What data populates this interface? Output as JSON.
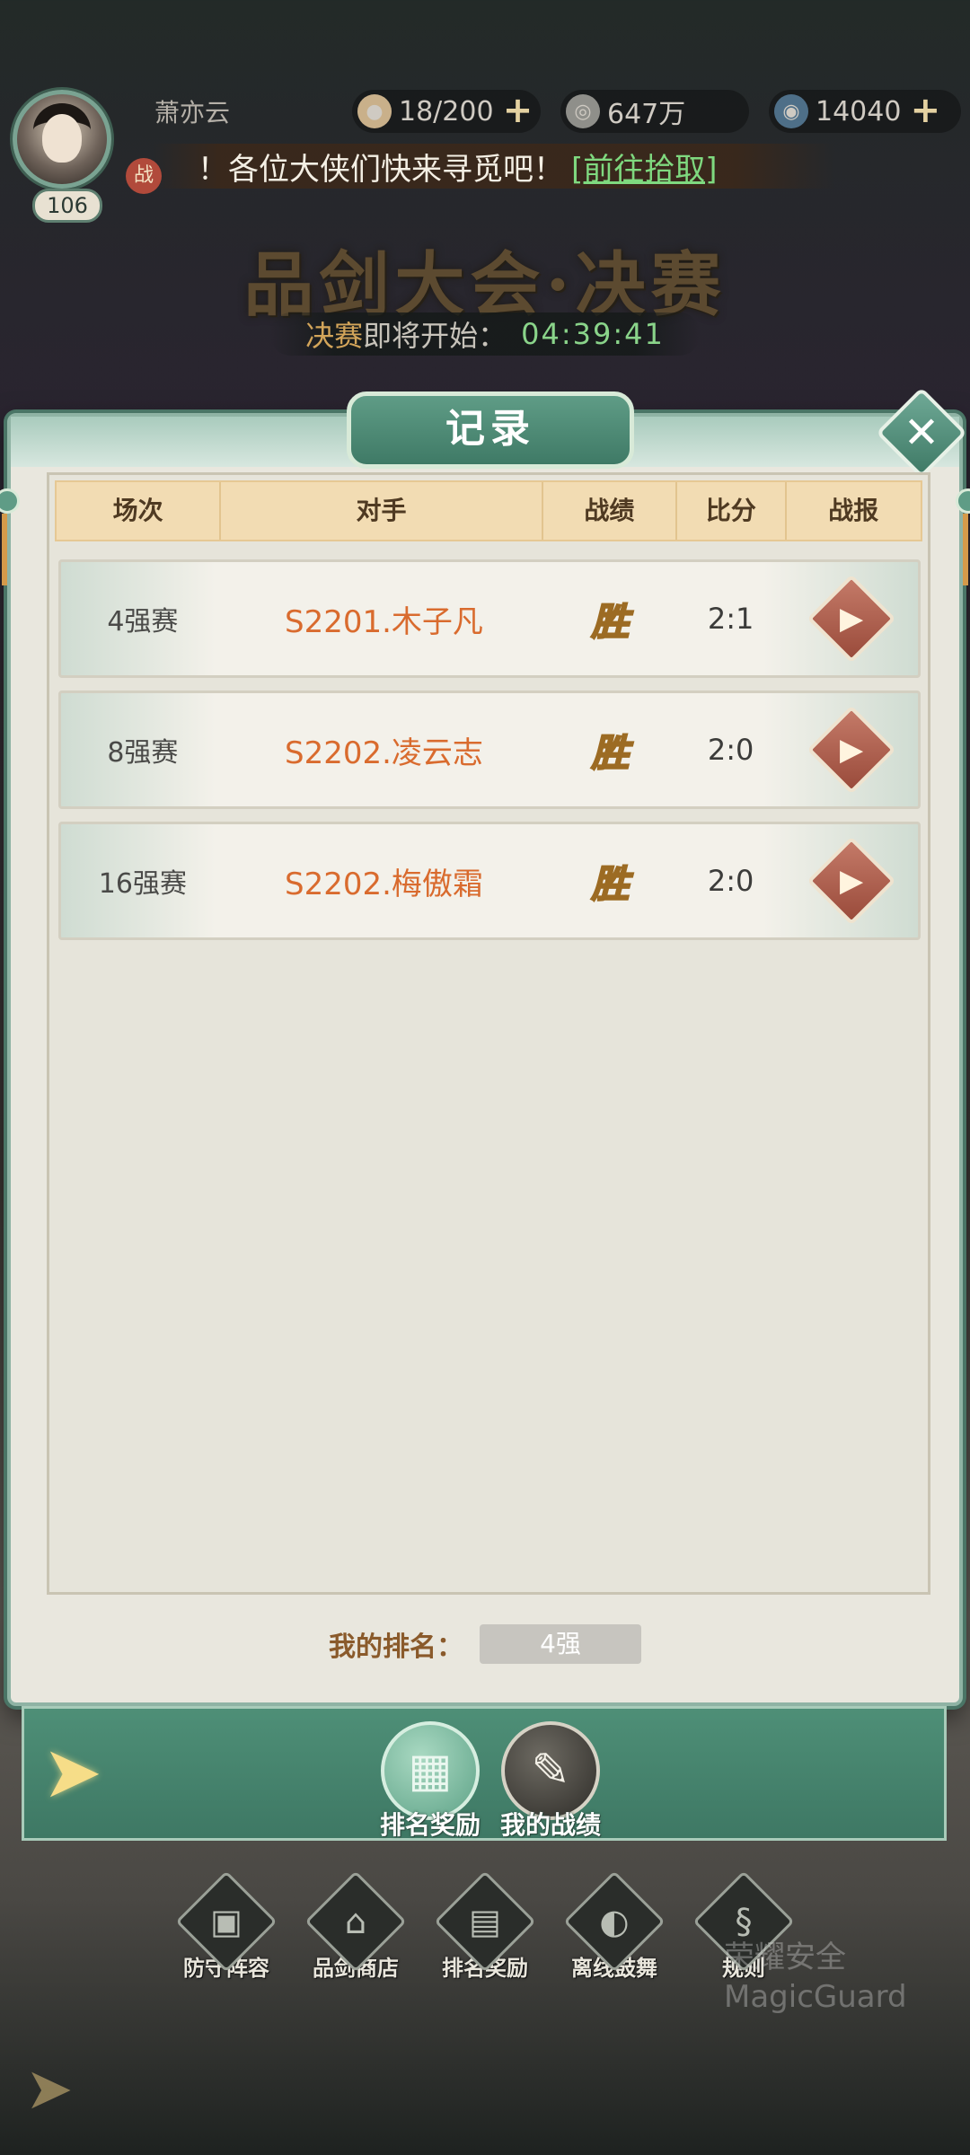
{
  "hud": {
    "player_name": "萧亦云",
    "level": "106",
    "battle_badge": "战",
    "stamina": "18/200",
    "coins": "647万",
    "gems": "14040",
    "ticker_text": "！各位大侠们快来寻觅吧！",
    "ticker_link": "[前往拾取]"
  },
  "event": {
    "title": "品剑大会·决赛",
    "stage": "决赛",
    "countdown_label": "即将开始：",
    "countdown_time": "04:39:41"
  },
  "panel": {
    "title": "记录",
    "close_glyph": "✕"
  },
  "table": {
    "headers": {
      "stage": "场次",
      "opponent": "对手",
      "result": "战绩",
      "score": "比分",
      "report": "战报"
    },
    "rows": [
      {
        "stage": "4强赛",
        "opponent": "S2201.木子凡",
        "result": "胜",
        "score": "2:1"
      },
      {
        "stage": "8强赛",
        "opponent": "S2202.凌云志",
        "result": "胜",
        "score": "2:0"
      },
      {
        "stage": "16强赛",
        "opponent": "S2202.梅傲霜",
        "result": "胜",
        "score": "2:0"
      }
    ]
  },
  "rank": {
    "label": "我的排名：",
    "value": "4强"
  },
  "bottom_tabs": {
    "rank_rewards": "排名奖励",
    "my_record": "我的战绩"
  },
  "bg_menu": {
    "defense": "防守阵容",
    "shop": "品剑商店",
    "rank_rewards": "排名奖励",
    "offline": "离线鼓舞",
    "rules": "规则"
  },
  "watermark": {
    "line1": "荣耀安全",
    "line2": "MagicGuard"
  },
  "colors": {
    "accent_green": "#3f7a66",
    "opponent_orange": "#d96b2e",
    "win_gold": "#f6d88a",
    "countdown_green": "#8ad48a"
  },
  "icons": {
    "stamina": "bun-icon",
    "coins": "coin-icon",
    "gems": "jade-icon",
    "replay": "video-camera-icon",
    "gift": "gift-icon",
    "record": "scroll-icon",
    "back": "back-arrow-icon"
  }
}
